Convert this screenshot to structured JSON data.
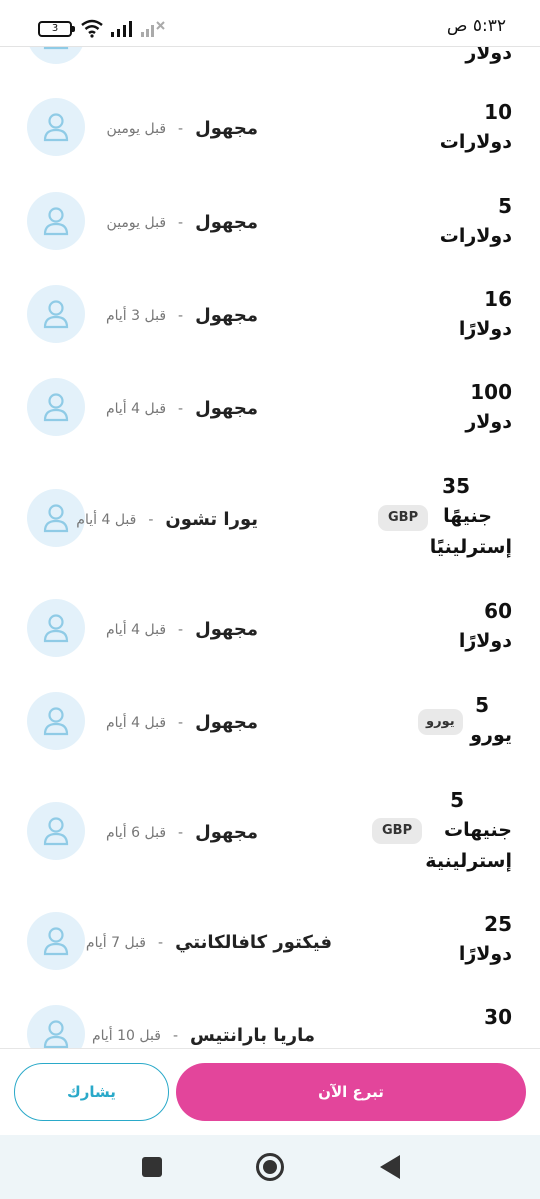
{
  "status_bar": {
    "time": "٥:٣٢ ص",
    "battery": "3"
  },
  "donations": [
    {
      "name": "",
      "time_ago": "",
      "amount": "",
      "currency": "دولار",
      "badge": ""
    },
    {
      "name": "مجهول",
      "time_ago": "قبل يومين",
      "amount": "10",
      "currency": "دولارات",
      "badge": ""
    },
    {
      "name": "مجهول",
      "time_ago": "قبل يومين",
      "amount": "5",
      "currency": "دولارات",
      "badge": ""
    },
    {
      "name": "مجهول",
      "time_ago": "قبل 3 أيام",
      "amount": "16",
      "currency": "دولارًا",
      "badge": ""
    },
    {
      "name": "مجهول",
      "time_ago": "قبل 4 أيام",
      "amount": "100",
      "currency": "دولار",
      "badge": ""
    },
    {
      "name": "يورا تشون",
      "time_ago": "قبل 4 أيام",
      "amount": "35",
      "currency": "جنيهًا",
      "currency2": "إسترلينيًا",
      "badge": "GBP"
    },
    {
      "name": "مجهول",
      "time_ago": "قبل 4 أيام",
      "amount": "60",
      "currency": "دولارًا",
      "badge": ""
    },
    {
      "name": "مجهول",
      "time_ago": "قبل 4 أيام",
      "amount": "5",
      "currency": "يورو",
      "badge": "يورو"
    },
    {
      "name": "مجهول",
      "time_ago": "قبل 6 أيام",
      "amount": "5",
      "currency": "جنيهات",
      "currency2": "إسترلينية",
      "badge": "GBP"
    },
    {
      "name": "فيكتور كافالكانتي",
      "time_ago": "قبل 7 أيام",
      "amount": "25",
      "currency": "دولارًا",
      "badge": ""
    },
    {
      "name": "ماريا بارانتيس",
      "time_ago": "قبل 10 أيام",
      "amount": "30",
      "currency": "",
      "badge": ""
    }
  ],
  "separator": "-",
  "actions": {
    "share_label": "يشارك",
    "donate_label": "تبرع الآن"
  },
  "colors": {
    "donate": "#e3459b",
    "share": "#2aa9c9",
    "avatar_bg": "#e3f1fa",
    "avatar_icon": "#8fcbe6"
  }
}
